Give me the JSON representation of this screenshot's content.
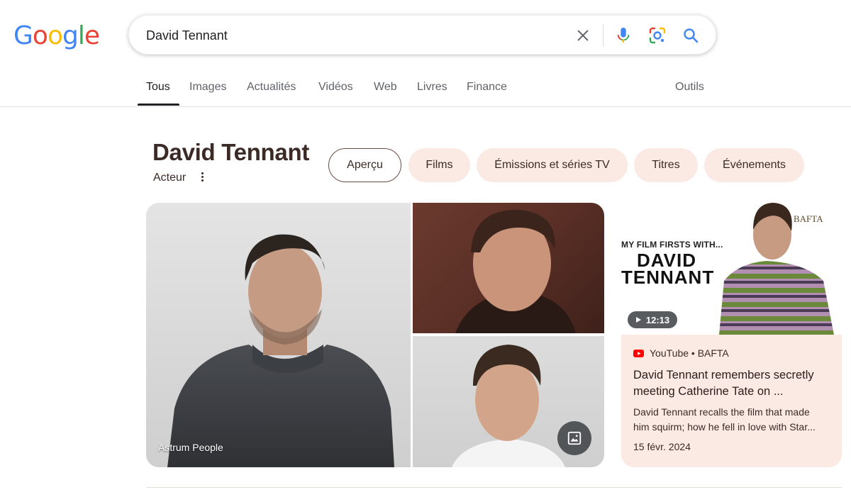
{
  "logo": {
    "letters": [
      "G",
      "o",
      "o",
      "g",
      "l",
      "e"
    ],
    "colors": [
      "#4285F4",
      "#EA4335",
      "#FBBC05",
      "#4285F4",
      "#34A853",
      "#EA4335"
    ]
  },
  "search": {
    "query": "David Tennant"
  },
  "tabs": [
    {
      "label": "Tous"
    },
    {
      "label": "Images"
    },
    {
      "label": "Actualités"
    },
    {
      "label": "Vidéos"
    },
    {
      "label": "Web"
    },
    {
      "label": "Livres"
    },
    {
      "label": "Finance"
    }
  ],
  "tools_label": "Outils",
  "knowledge": {
    "title": "David Tennant",
    "subtitle": "Acteur",
    "chips": [
      {
        "label": "Aperçu",
        "selected": true
      },
      {
        "label": "Films"
      },
      {
        "label": "Émissions et séries TV"
      },
      {
        "label": "Titres"
      },
      {
        "label": "Événements"
      }
    ]
  },
  "images": {
    "main_caption": "Astrum People"
  },
  "video": {
    "thumb_small_text": "MY FILM FIRSTS WITH...",
    "thumb_line1": "DAVID",
    "thumb_line2": "TENNANT",
    "thumb_brand": "BAFTA",
    "duration": "12:13",
    "source": "YouTube • BAFTA",
    "title": "David Tennant remembers secretly meeting Catherine Tate on ...",
    "desc_line1": "David Tennant recalls the film that made",
    "desc_line2": "him squirm; how he fell in love with Star...",
    "date": "15 févr. 2024"
  },
  "colors": {
    "accent_chip": "#fbe9e4",
    "title_text": "#3b2a25",
    "youtube_red": "#ff0000"
  }
}
